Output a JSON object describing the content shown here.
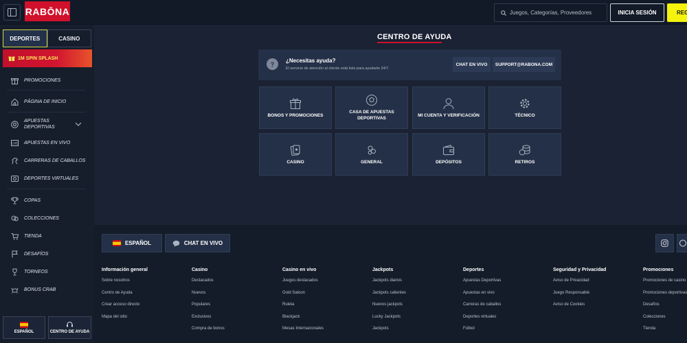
{
  "header": {
    "logo": "RABŌNA",
    "search_placeholder": "Juegos, Categorías, Proveedores",
    "login_label": "INICIA SESIÓN",
    "register_label": "REG"
  },
  "sidebar": {
    "tabs": [
      "DEPORTES",
      "CASINO"
    ],
    "promo_label": "1M SPIN SPLASH",
    "items": [
      {
        "label": "PROMOCIONES",
        "icon": "gift-icon"
      },
      {
        "label": "PÁGINA DE INICIO",
        "icon": "home-icon"
      },
      {
        "label": "APUESTAS DEPORTIVAS",
        "icon": "soccer-ball-icon"
      },
      {
        "label": "APUESTAS EN VIVO",
        "icon": "live-icon"
      },
      {
        "label": "CARRERAS DE CABALLOS",
        "icon": "horse-icon"
      },
      {
        "label": "DEPORTES VIRTUALES",
        "icon": "virtual-icon"
      },
      {
        "label": "COPAS",
        "icon": "trophy-icon"
      },
      {
        "label": "COLECCIONES",
        "icon": "collections-icon"
      },
      {
        "label": "TIENDA",
        "icon": "cart-icon"
      },
      {
        "label": "DESAFÍOS",
        "icon": "flag-icon"
      },
      {
        "label": "TORNEOS",
        "icon": "trophy-icon"
      },
      {
        "label": "BONUS CRAB",
        "icon": "crab-icon"
      }
    ],
    "bottom": {
      "language": "ESPAÑOL",
      "help": "CENTRO DE AYUDA"
    }
  },
  "help": {
    "title": "CENTRO DE AYUDA",
    "question": "¿Necesitas ayuda?",
    "subtitle": "El servicio de atención al cliente está listo para ayudarte 24/7.",
    "chat_label": "CHAT EN VIVO",
    "support_label": "SUPPORT@RABONA.COM",
    "cards": [
      {
        "label": "BONOS Y PROMOCIONES",
        "icon": "gift-icon"
      },
      {
        "label": "CASA DE APUESTAS DEPORTIVAS",
        "icon": "soccer-ball-icon"
      },
      {
        "label": "MI CUENTA Y VERIFICACIÓN",
        "icon": "user-icon"
      },
      {
        "label": "TÉCNICO",
        "icon": "gear-icon"
      },
      {
        "label": "CASINO",
        "icon": "cards-icon"
      },
      {
        "label": "GENERAL",
        "icon": "general-icon"
      },
      {
        "label": "DEPÓSITOS",
        "icon": "wallet-icon"
      },
      {
        "label": "RETIROS",
        "icon": "coins-icon"
      }
    ]
  },
  "footer": {
    "language_label": "ESPAÑOL",
    "chat_label": "CHAT EN VIVO",
    "columns": [
      {
        "title": "Información general",
        "links": [
          "Sobre nosotros",
          "Centro de Ayuda",
          "Crear acceso directo",
          "Mapa del sitio"
        ]
      },
      {
        "title": "Casino",
        "links": [
          "Destacados",
          "Nuevos",
          "Populares",
          "Exclusivos",
          "Compra de bonos"
        ]
      },
      {
        "title": "Casino en vivo",
        "links": [
          "Juegos destacados",
          "Gold Saloon",
          "Ruleta",
          "Blackjack",
          "Mesas Internacionales"
        ]
      },
      {
        "title": "Jackpots",
        "links": [
          "Jackpots diarios",
          "Jackpots calientes",
          "Nuevos jackpots",
          "Lucky Jackpots",
          "Jackpots"
        ]
      },
      {
        "title": "Deportes",
        "links": [
          "Apuestas Deportivas",
          "Apuestas en vivo",
          "Carreras de caballos",
          "Deportes virtuales",
          "Fútbol"
        ]
      },
      {
        "title": "Seguridad y Privacidad",
        "links": [
          "Aviso de Privacidad",
          "Juego Responsable",
          "Aviso de Cookies"
        ]
      },
      {
        "title": "Promociones",
        "links": [
          "Promociones de casino",
          "Promociones deportivas",
          "Desafíos",
          "Colecciones",
          "Tienda"
        ]
      }
    ]
  },
  "colors": {
    "brand_red": "#d1102b",
    "register_yellow": "#f5f30e",
    "bg": "#1a2233"
  }
}
